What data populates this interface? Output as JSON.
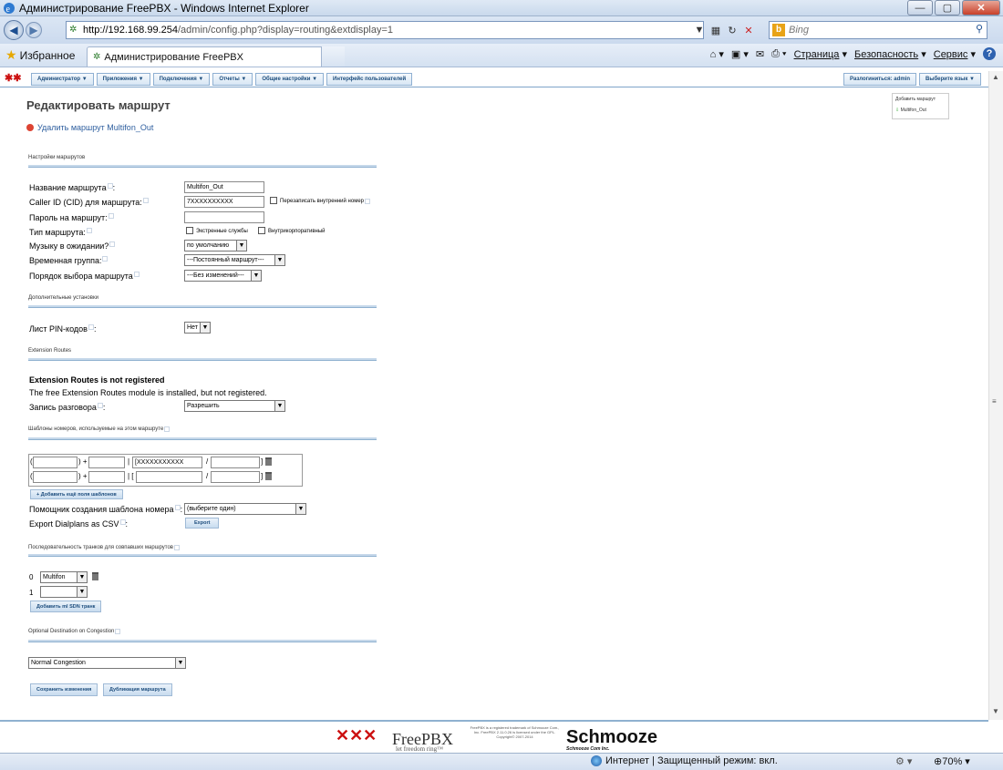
{
  "window": {
    "title": "Администрирование FreePBX - Windows Internet Explorer",
    "minimize": "—",
    "maximize": "▢",
    "close": "✕"
  },
  "address": {
    "url_host": "http://192.168.99.254",
    "url_path": "/admin/config.php?display=routing&extdisplay=1",
    "search_placeholder": "Bing",
    "search_go": "⚲"
  },
  "favbar": {
    "favorites_label": "Избранное",
    "tab_title": "Администрирование FreePBX",
    "page_menu": "Страница",
    "safety_menu": "Безопасность",
    "tools_menu": "Сервис",
    "help": "?"
  },
  "pbxnav": {
    "menus": [
      "Администратор ▼",
      "Приложения ▼",
      "Подключения ▼",
      "Отчеты ▼",
      "Общие настройки ▼",
      "Интерфейс пользователей"
    ],
    "logout": "Разлогиниться: admin",
    "language": "Выберите язык ▼"
  },
  "sidebar": {
    "add_route": "Добавить маршрут",
    "route_item": "Multifon_Out"
  },
  "page": {
    "heading": "Редактировать маршрут",
    "delete_link": "Удалить маршрут Multifon_Out",
    "section_route_settings": "Настройки маршрутов",
    "route_name_label": "Название маршрута",
    "route_name_value": "Multifon_Out",
    "cid_label": "Caller ID (CID) для маршрута:",
    "cid_value": "7XXXXXXXXXX",
    "override_ext_label": "Перезаписать внутренний номер",
    "password_label": "Пароль на маршрут:",
    "route_type_label": "Тип маршрута:",
    "emergency_label": "Экстренные службы",
    "intracompany_label": "Внутрикорпоративный",
    "moh_label": "Музыку в ожидании?",
    "moh_value": "по умолчанию",
    "time_group_label": "Временная группа:",
    "time_group_value": "---Постоянный маршрут---",
    "route_order_label": "Порядок выбора маршрута",
    "route_order_value": "---Без изменений---",
    "section_additional": "Дополнительные установки",
    "pin_list_label": "Лист PIN-кодов",
    "pin_list_value": "Нет",
    "section_ext_routes": "Extension Routes",
    "ext_routes_title": "Extension Routes is not registered",
    "ext_routes_desc": "The free Extension Routes module is installed, but not registered.",
    "call_record_label": "Запись разговора",
    "call_record_value": "Разрешить",
    "section_patterns": "Шаблоны номеров, используемые на этом маршруте",
    "pattern_rows": [
      {
        "prepend": "",
        "prefix": "",
        "match": "[XXXXXXXXXXX",
        "cid": ""
      },
      {
        "prepend": "",
        "prefix": "",
        "match": "",
        "cid": ""
      }
    ],
    "add_pattern_button": "+ Добавить ещё поля шаблонов",
    "wizard_label": "Помощник создания шаблона номера",
    "wizard_value": "(выберите один)",
    "export_label": "Export Dialplans as CSV",
    "export_button": "Export",
    "section_trunks": "Последовательность транков для совпавших маршрутов",
    "trunks": [
      {
        "index": "0",
        "value": "Multifon"
      },
      {
        "index": "1",
        "value": ""
      }
    ],
    "add_trunk_button": "Добавить ml SDN транк",
    "section_congestion": "Optional Destination on Congestion",
    "congestion_value": "Normal Congestion",
    "save_button": "Сохранить изменения",
    "duplicate_button": "Дубликация маршрута"
  },
  "footer": {
    "freepbx_name": "FreePBX",
    "freepbx_tag": "let freedom ring™",
    "legal": "FreePBX is a registered trademark of Schmooze Com., Inc. FreePBX 2.11.0.26 is licensed under the GPL. Copyright© 2007-2014",
    "schmooze": "Schmooze",
    "schmooze_sub": "Schmooze Com Inc."
  },
  "status": {
    "zone": "Интернет | Защищенный режим: вкл.",
    "zoom": "70%"
  },
  "colors": {
    "accent": "#2f5f9f",
    "nav_text": "#1d4d7d",
    "close_button": "#c8402a"
  }
}
